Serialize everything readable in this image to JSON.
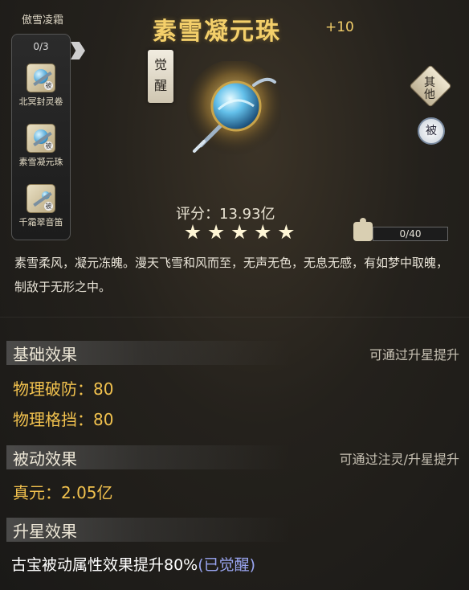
{
  "set": {
    "title": "傲雪凌霜",
    "count": "0/3",
    "items": [
      {
        "label": "北冥封灵卷",
        "tag": "被"
      },
      {
        "label": "素雪凝元珠",
        "tag": "被"
      },
      {
        "label": "千霜翠音笛",
        "tag": "被"
      }
    ]
  },
  "item": {
    "name": "素雪凝元珠",
    "level": "+10",
    "awaken_label": "觉醒",
    "score": "评分：13.93亿",
    "stars": 5,
    "description": "素雪柔风，凝元冻魄。漫天飞雪和风而至，无声无色，无息无感，有如梦中取魄，制敌于无形之中。"
  },
  "badges": {
    "other": "其他",
    "passive": "被"
  },
  "fragments": {
    "progress_text": "0/40",
    "progress": 0
  },
  "sections": {
    "basic": {
      "title": "基础效果",
      "hint": "可通过升星提升",
      "stats": [
        "物理破防：80",
        "物理格挡：80"
      ]
    },
    "passive": {
      "title": "被动效果",
      "hint": "可通过注灵/升星提升",
      "stats": [
        "真元：2.05亿"
      ]
    },
    "star": {
      "title": "升星效果",
      "effect": "古宝被动属性效果提升80%",
      "effect_tag": "(已觉醒)"
    }
  },
  "colors": {
    "title_gold": "#f3cf6a",
    "stat_gold": "#f2c24e",
    "awakened_tag": "#9aa6f2"
  }
}
